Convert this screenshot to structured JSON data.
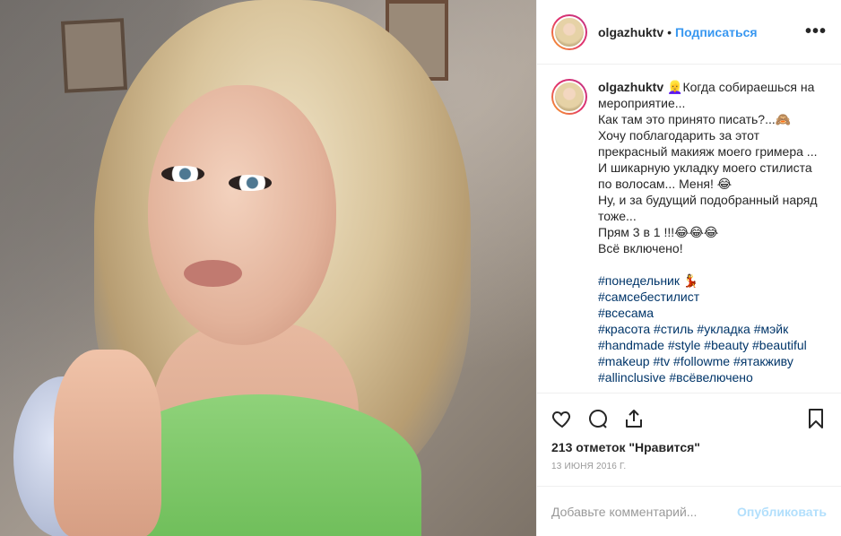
{
  "header": {
    "username": "olgazhuktv",
    "separator": "•",
    "follow_label": "Подписаться",
    "more_label": "•••"
  },
  "caption": {
    "username": "olgazhuktv",
    "text": "👱‍♀️Когда собираешься на мероприятие...\nКак там это принято писать?...🙈\nХочу поблагодарить за этот прекрасный макияж моего гримера ... И шикарную укладку моего стилиста по волосам... Меня! 😂\nНу, и за будущий подобранный наряд тоже...\nПрям 3 в 1 !!!😂😂😂\nВсё включено!",
    "tags": [
      "#понедельник 💃",
      "#самсебестилист",
      "#всесама",
      "#красота #стиль #укладка #мэйк",
      "#handmade #style #beauty #beautiful",
      "#makeup #tv #followme #ятакживу",
      "#allinclusive #всёвелючено"
    ]
  },
  "actions": {
    "likes": "213 отметок \"Нравится\"",
    "date": "13 июня 2016 г."
  },
  "comment_box": {
    "placeholder": "Добавьте комментарий...",
    "publish_label": "Опубликовать"
  },
  "icons": [
    "heart-icon",
    "comment-icon",
    "share-icon",
    "bookmark-icon",
    "more-icon"
  ]
}
